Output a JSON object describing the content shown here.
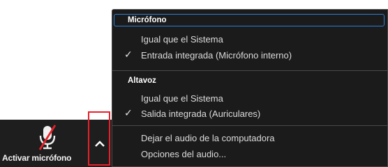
{
  "toolbar": {
    "mic_button_label": "Activar micrófono",
    "mic_icon": "microphone-muted-icon",
    "chevron_icon": "chevron-up-icon"
  },
  "menu": {
    "microphone_header": "Micrófono",
    "microphone_items": [
      {
        "label": "Igual que el Sistema",
        "checked": false
      },
      {
        "label": "Entrada integrada (Micrófono interno)",
        "checked": true
      }
    ],
    "speaker_header": "Altavoz",
    "speaker_items": [
      {
        "label": "Igual que el Sistema",
        "checked": false
      },
      {
        "label": "Salida integrada (Auriculares)",
        "checked": true
      }
    ],
    "actions": [
      {
        "label": "Dejar el audio de la computadora"
      },
      {
        "label": "Opciones del audio..."
      }
    ],
    "check_glyph": "✓"
  },
  "colors": {
    "menu_background": "#1b1b1b",
    "focus_border": "#2d7fd8",
    "callout_red": "#e8202a",
    "mute_slash": "#e8202a"
  }
}
